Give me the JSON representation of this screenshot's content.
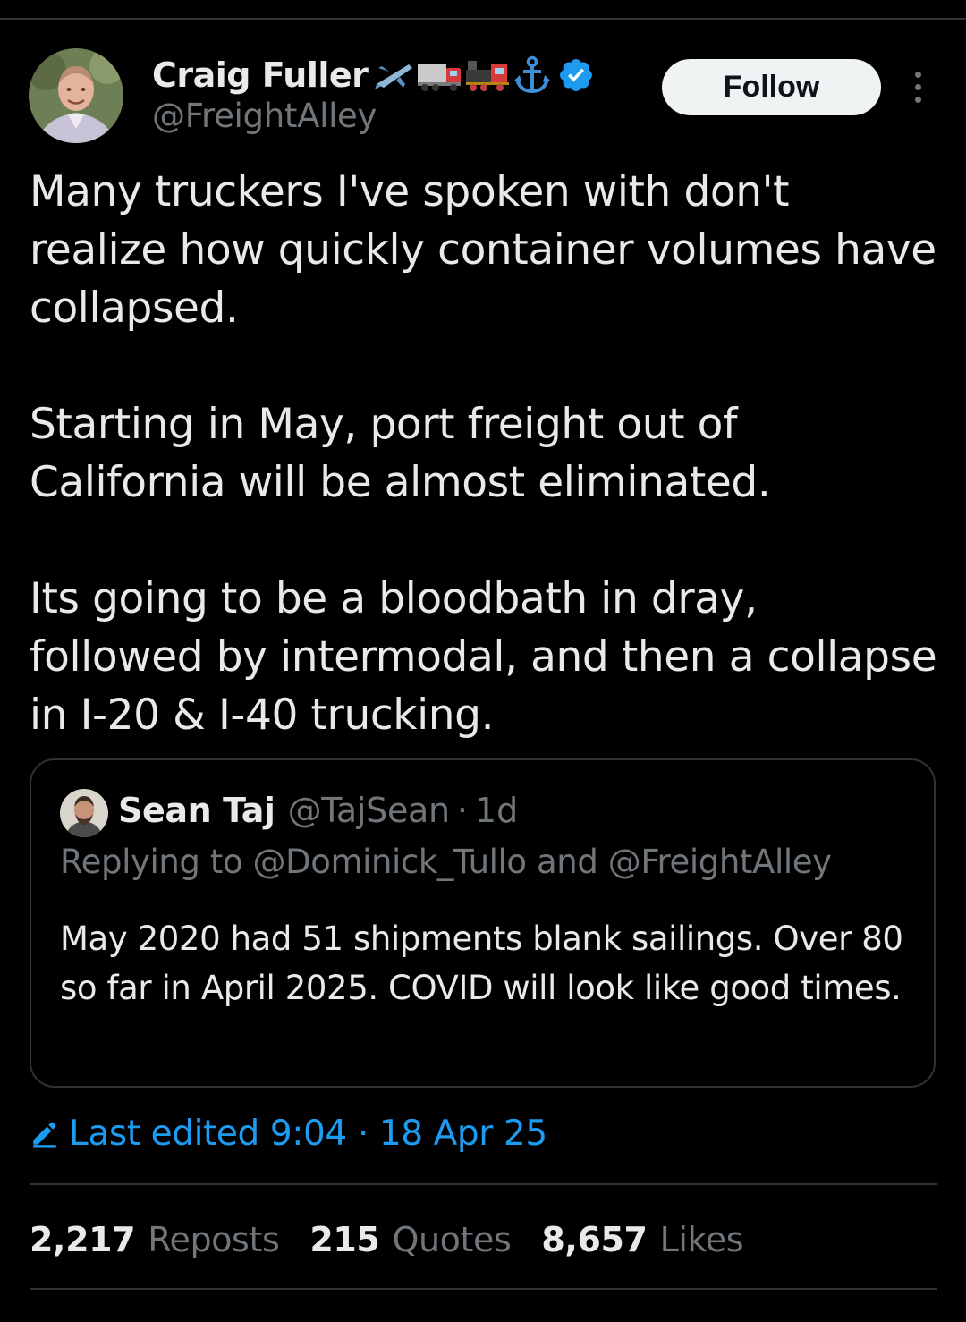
{
  "author": {
    "display_name": "Craig Fuller",
    "name_emojis": [
      "airplane-emoji",
      "truck-emoji",
      "locomotive-emoji",
      "anchor-emoji"
    ],
    "verified_badge": "verified-badge-icon",
    "handle": "@FreightAlley"
  },
  "follow_label": "Follow",
  "tweet": {
    "paragraphs": [
      "Many truckers I've spoken with don't realize how quickly container volumes have collapsed.",
      "Starting in May, port freight out of California will be almost eliminated.",
      "Its going to be a bloodbath in dray, followed by intermodal, and then a collapse in I-20 & I-40 trucking."
    ]
  },
  "quote": {
    "name": "Sean Taj",
    "handle": "@TajSean",
    "separator": "·",
    "time": "1d",
    "replying_to": "Replying to @Dominick_Tullo and @FreightAlley",
    "text": "May 2020 had 51 shipments blank sailings. Over 80 so far in April 2025. COVID will look like good times."
  },
  "edited": {
    "text": "Last edited 9:04 · 18 Apr 25"
  },
  "stats": {
    "reposts_count": "2,217",
    "reposts_label": "Reposts",
    "quotes_count": "215",
    "quotes_label": "Quotes",
    "likes_count": "8,657",
    "likes_label": "Likes"
  },
  "colors": {
    "background": "#000000",
    "text_primary": "#e7e9ea",
    "text_secondary": "#71767b",
    "accent_blue": "#1d9bf0",
    "border": "#2f3336",
    "follow_bg": "#eff3f4"
  }
}
